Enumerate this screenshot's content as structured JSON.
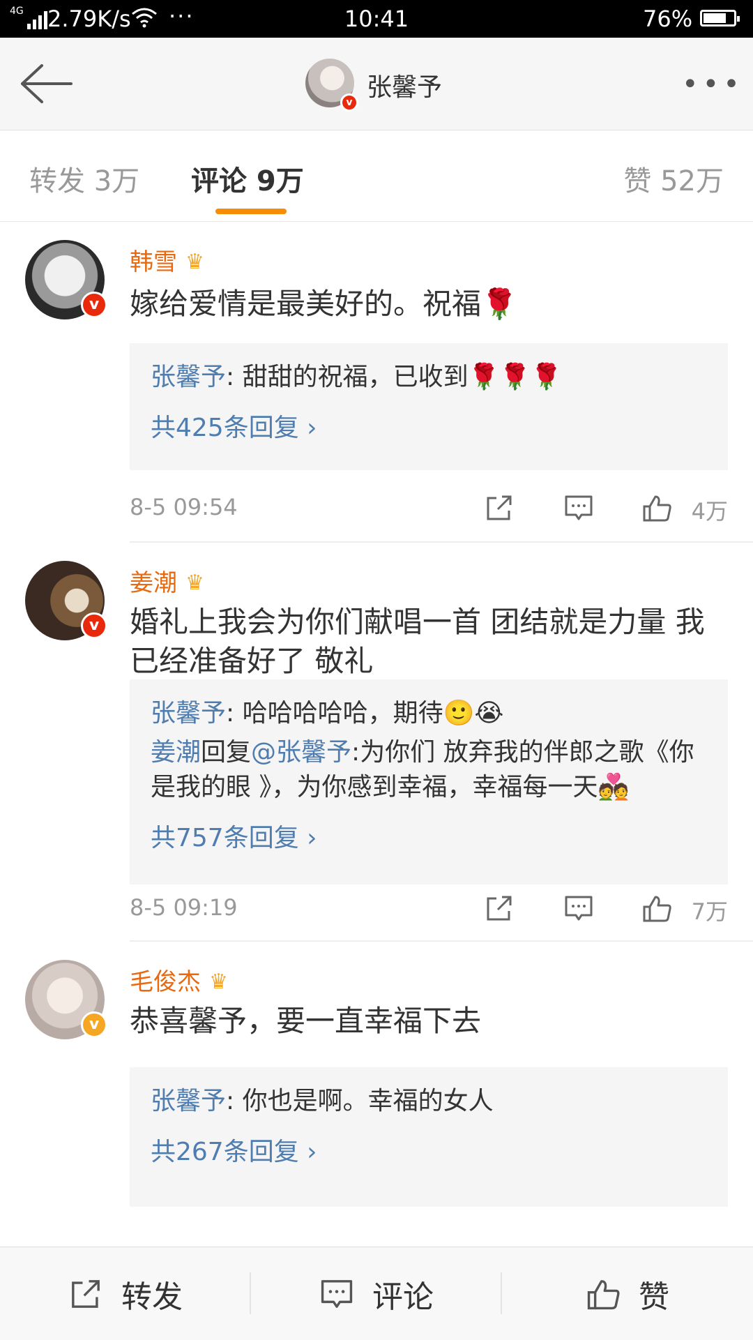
{
  "status": {
    "speed": "2.79K/s",
    "network": "4G",
    "time": "10:41",
    "battery": "76%",
    "dots": "···"
  },
  "header": {
    "title": "张馨予",
    "more": "•••"
  },
  "tabs": {
    "repost": "转发 3万",
    "comment": "评论 9万",
    "likes": "赞 52万"
  },
  "comments": [
    {
      "name": "韩雪",
      "text": "嫁给爱情是最美好的。祝福🌹",
      "replies": [
        {
          "name": "张馨予",
          "sep": ": ",
          "text": "甜甜的祝福，已收到🌹🌹🌹"
        }
      ],
      "more": "共425条回复 ›",
      "time": "8-5 09:54",
      "likes": "4万"
    },
    {
      "name": "姜潮",
      "text": "婚礼上我会为你们献唱一首 团结就是力量 我已经准备好了 敬礼",
      "replies": [
        {
          "name": "张馨予",
          "sep": ": ",
          "text": "哈哈哈哈哈，期待🙂😭"
        },
        {
          "name": "姜潮",
          "mid": "回复",
          "at": "@张馨予",
          "sep": ":",
          "text": "为你们 放弃我的伴郎之歌《你是我的眼 》，为你感到幸福，幸福每一天💑"
        }
      ],
      "more": "共757条回复 ›",
      "time": "8-5 09:19",
      "likes": "7万"
    },
    {
      "name": "毛俊杰",
      "text": "恭喜馨予，要一直幸福下去",
      "replies": [
        {
          "name": "张馨予",
          "sep": ": ",
          "text": "你也是啊。幸福的女人"
        }
      ],
      "more": "共267条回复 ›"
    }
  ],
  "bottom": {
    "repost": "转发",
    "comment": "评论",
    "like": "赞"
  },
  "icons": {
    "back": "back-arrow-icon",
    "share": "share-icon",
    "comment": "comment-icon",
    "like": "thumbs-up-icon",
    "crown": "crown-icon",
    "verified": "verified-v-icon"
  },
  "colors": {
    "accent": "#f78d06",
    "username": "#e86a10",
    "link": "#507daf",
    "verified_red": "#e8290b",
    "verified_gold": "#f5a623"
  }
}
